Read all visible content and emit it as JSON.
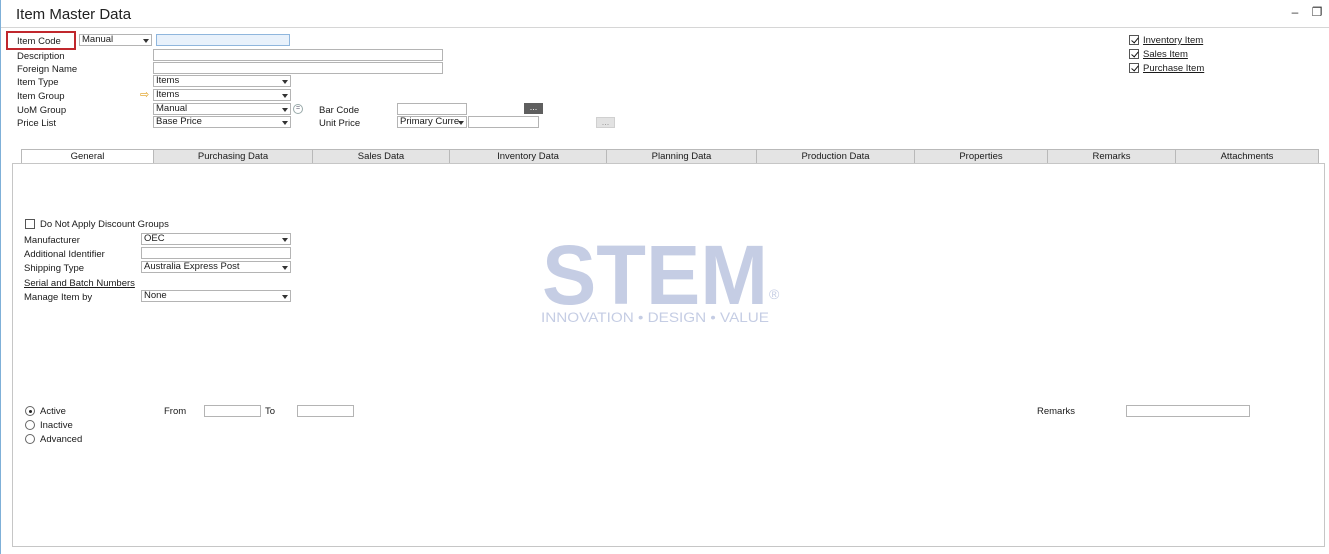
{
  "window": {
    "title": "Item Master Data",
    "min_glyph": "–",
    "restore_glyph": "❐"
  },
  "header": {
    "item_code_label": "Item Code",
    "numbering_series": "Manual",
    "item_code_value": "",
    "description_label": "Description",
    "description_value": "",
    "foreign_name_label": "Foreign Name",
    "foreign_name_value": "",
    "item_type_label": "Item Type",
    "item_type_value": "Items",
    "item_group_label": "Item Group",
    "item_group_value": "Items",
    "uom_group_label": "UoM Group",
    "uom_group_value": "Manual",
    "price_list_label": "Price List",
    "price_list_value": "Base Price",
    "bar_code_label": "Bar Code",
    "bar_code_value": "",
    "unit_price_label": "Unit Price",
    "currency_value": "Primary Curre",
    "unit_price_value": "",
    "dots": "...",
    "checks": [
      {
        "label": "Inventory Item",
        "checked": true
      },
      {
        "label": "Sales Item",
        "checked": true
      },
      {
        "label": "Purchase Item",
        "checked": true
      }
    ]
  },
  "tabs": [
    "General",
    "Purchasing Data",
    "Sales Data",
    "Inventory Data",
    "Planning Data",
    "Production Data",
    "Properties",
    "Remarks",
    "Attachments"
  ],
  "active_tab": "General",
  "general": {
    "discount_groups_label": "Do Not Apply Discount Groups",
    "manufacturer_label": "Manufacturer",
    "manufacturer_value": "OEC",
    "additional_identifier_label": "Additional Identifier",
    "additional_identifier_value": "",
    "shipping_type_label": "Shipping Type",
    "shipping_type_value": "Australia Express Post",
    "serial_batch_link": "Serial and Batch Numbers",
    "manage_item_by_label": "Manage Item by",
    "manage_item_by_value": "None",
    "status_options": [
      {
        "label": "Active",
        "selected": true
      },
      {
        "label": "Inactive",
        "selected": false
      },
      {
        "label": "Advanced",
        "selected": false
      }
    ],
    "from_label": "From",
    "to_label": "To",
    "remarks_label": "Remarks"
  },
  "watermark": {
    "brand": "STEM",
    "tagline": "INNOVATION • DESIGN • VALUE",
    "registered": "®",
    "color": "#c5cde4"
  }
}
